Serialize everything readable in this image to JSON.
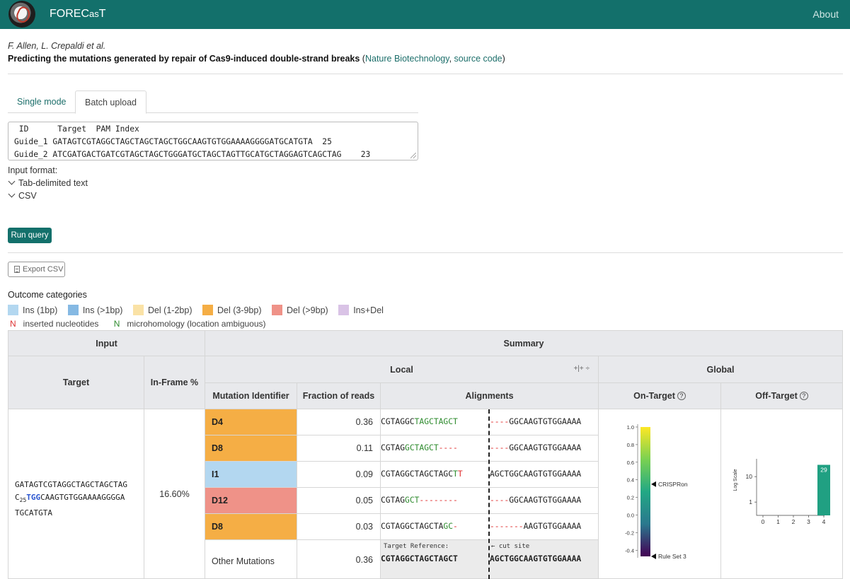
{
  "app": {
    "title": "FOREC",
    "title_cas": "as",
    "title_t": "T",
    "about": "About"
  },
  "paper": {
    "authors": "F. Allen, L. Crepaldi et al.",
    "title": "Predicting the mutations generated by repair of Cas9-induced double-strand breaks",
    "open": " (",
    "journal_link": "Nature Biotechnology",
    "sep": ", ",
    "code_link": "source code",
    "close": ")"
  },
  "tabs": [
    {
      "label": "Single mode"
    },
    {
      "label": "Batch upload"
    }
  ],
  "batch_input": {
    "lines": [
      " ID      Target  PAM Index",
      "Guide_1 GATAGTCGTAGGCTAGCTAGCTAGCTGGCAAGTGTGGAAAAGGGGATGCATGTA  25",
      "Guide_2 ATCGATGACTGATCGTAGCTAGCTGGGATGCTAGCTAGTTGCATGCTAGGAGTCAGCTAG    23"
    ]
  },
  "input_format": {
    "label": "Input format:",
    "options": [
      "Tab-delimited text",
      "CSV"
    ]
  },
  "run_button": "Run query",
  "export_button": "Export CSV",
  "outcome_categories": {
    "title": "Outcome categories",
    "items": [
      {
        "label": "Ins (1bp)",
        "color": "#b3d7f0"
      },
      {
        "label": "Ins (>1bp)",
        "color": "#85b9e3"
      },
      {
        "label": "Del (1-2bp)",
        "color": "#fae2a6"
      },
      {
        "label": "Del (3-9bp)",
        "color": "#f5ae45"
      },
      {
        "label": "Del (>9bp)",
        "color": "#ef9288"
      },
      {
        "label": "Ins+Del",
        "color": "#d9c3e6"
      }
    ],
    "notes": [
      {
        "symbol": "N",
        "label": "inserted nucleotides"
      },
      {
        "symbol": "N",
        "label": "microhomology (location ambiguous)"
      }
    ]
  },
  "table": {
    "headers": {
      "input": "Input",
      "summary": "Summary",
      "target": "Target",
      "inframe": "In-Frame %",
      "local": "Local",
      "global": "Global",
      "mutation_id": "Mutation Identifier",
      "fraction": "Fraction of reads",
      "alignments": "Alignments",
      "on_target": "On-Target",
      "off_target": "Off-Target"
    },
    "row": {
      "target_line1": "GATAGTCGTAGGCTAGCTAGCTAG",
      "target_line2_pre": "C",
      "target_line2_sub": "25",
      "target_line2_pam": "TGG",
      "target_line2_post": "CAAGTGTGGAAAAGGGGA",
      "target_line3": "TGCATGTA",
      "inframe": "16.60%",
      "mutations": [
        {
          "id": "D4",
          "fraction": "0.36",
          "color": "#f5ae45",
          "left": [
            {
              "t": "CGTAGGC",
              "c": ""
            },
            {
              "t": "TAGCTAGCT",
              "c": "green"
            }
          ],
          "right": [
            {
              "t": "----",
              "c": "red"
            },
            {
              "t": "GGCAAGTGTGGAAAA",
              "c": ""
            }
          ]
        },
        {
          "id": "D8",
          "fraction": "0.11",
          "color": "#f5ae45",
          "left": [
            {
              "t": "CGTAG",
              "c": ""
            },
            {
              "t": "GCTAGCT",
              "c": "green"
            },
            {
              "t": "----",
              "c": "red"
            }
          ],
          "right": [
            {
              "t": "----",
              "c": "red"
            },
            {
              "t": "GGCAAGTGTGGAAAA",
              "c": ""
            }
          ]
        },
        {
          "id": "I1",
          "fraction": "0.09",
          "color": "#b3d7f0",
          "left": [
            {
              "t": "CGTAGGCTAGCTAGC",
              "c": ""
            },
            {
              "t": "T",
              "c": "green"
            },
            {
              "t": "T",
              "c": "red"
            }
          ],
          "right": [
            {
              "t": "AGCTGGCAAGTGTGGAAAA",
              "c": ""
            }
          ]
        },
        {
          "id": "D12",
          "fraction": "0.05",
          "color": "#ef9288",
          "left": [
            {
              "t": "CGTAG",
              "c": ""
            },
            {
              "t": "GCT",
              "c": "green"
            },
            {
              "t": "--------",
              "c": "red"
            }
          ],
          "right": [
            {
              "t": "----",
              "c": "red"
            },
            {
              "t": "GGCAAGTGTGGAAAA",
              "c": ""
            }
          ]
        },
        {
          "id": "D8",
          "fraction": "0.03",
          "color": "#f5ae45",
          "left": [
            {
              "t": "CGTAGGCTAGCTA",
              "c": ""
            },
            {
              "t": "GC",
              "c": "green"
            },
            {
              "t": "-",
              "c": "red"
            }
          ],
          "right": [
            {
              "t": "-------",
              "c": "red"
            },
            {
              "t": "AAGTGTGGAAAA",
              "c": ""
            }
          ]
        }
      ],
      "other": {
        "label": "Other Mutations",
        "fraction": "0.36"
      },
      "reference": {
        "label": "Target Reference:",
        "cut_label": "←  cut site",
        "left": "CGTAGGCTAGCTAGCT",
        "right": "AGCTGGCAAGTGTGGAAAA"
      }
    }
  },
  "on_target_scale": {
    "ticks": [
      "1.0",
      "0.8",
      "0.6",
      "0.4",
      "0.2",
      "0.0",
      "-0.2",
      "-0.4"
    ],
    "markers": [
      {
        "label": "CRISPRon",
        "value": 0.35
      },
      {
        "label": "Rule Set 3",
        "value": -0.47
      }
    ]
  },
  "chart_data": {
    "type": "bar",
    "ylabel": "Log Scale",
    "yscale": "log",
    "yticks": [
      "1",
      "10"
    ],
    "categories": [
      "0",
      "1",
      "2",
      "3",
      "4"
    ],
    "values": [
      0,
      0,
      0,
      0,
      29
    ],
    "data_labels": [
      "",
      "",
      "",
      "",
      "29"
    ],
    "bar_color": "#20a082"
  }
}
